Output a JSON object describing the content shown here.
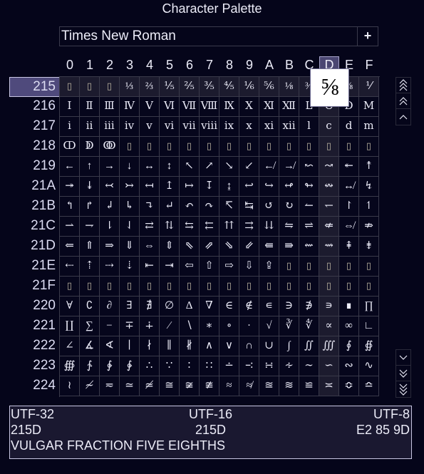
{
  "window": {
    "title": "Character Palette"
  },
  "font_selector": {
    "value": "Times New Roman",
    "add_button_label": "+"
  },
  "columns": [
    "0",
    "1",
    "2",
    "3",
    "4",
    "5",
    "6",
    "7",
    "8",
    "9",
    "A",
    "B",
    "C",
    "D",
    "E",
    "F"
  ],
  "hover": {
    "row": "215",
    "column": "D"
  },
  "missing_glyph": "▯",
  "rows": [
    {
      "label": "215",
      "chars": [
        "▯",
        "▯",
        "▯",
        "⅓",
        "⅔",
        "⅕",
        "⅖",
        "⅗",
        "⅘",
        "⅙",
        "⅚",
        "⅛",
        "⅜",
        "⅝",
        "⅞",
        "⅟"
      ]
    },
    {
      "label": "216",
      "chars": [
        "Ⅰ",
        "Ⅱ",
        "Ⅲ",
        "Ⅳ",
        "Ⅴ",
        "Ⅵ",
        "Ⅶ",
        "Ⅷ",
        "Ⅸ",
        "Ⅹ",
        "Ⅺ",
        "Ⅻ",
        "Ⅼ",
        "Ⅽ",
        "Ⅾ",
        "Ⅿ"
      ]
    },
    {
      "label": "217",
      "chars": [
        "ⅰ",
        "ⅱ",
        "ⅲ",
        "ⅳ",
        "ⅴ",
        "ⅵ",
        "ⅶ",
        "ⅷ",
        "ⅸ",
        "ⅹ",
        "ⅺ",
        "ⅻ",
        "ⅼ",
        "ⅽ",
        "ⅾ",
        "ⅿ"
      ]
    },
    {
      "label": "218",
      "chars": [
        "ↀ",
        "ↁ",
        "ↂ",
        "▯",
        "▯",
        "▯",
        "▯",
        "▯",
        "▯",
        "▯",
        "▯",
        "▯",
        "▯",
        "▯",
        "▯",
        "▯"
      ]
    },
    {
      "label": "219",
      "chars": [
        "←",
        "↑",
        "→",
        "↓",
        "↔",
        "↕",
        "↖",
        "↗",
        "↘",
        "↙",
        "↚",
        "↛",
        "↜",
        "↝",
        "↞",
        "↟"
      ]
    },
    {
      "label": "21A",
      "chars": [
        "↠",
        "↡",
        "↢",
        "↣",
        "↤",
        "↥",
        "↦",
        "↧",
        "↨",
        "↩",
        "↪",
        "↫",
        "↬",
        "↭",
        "↮",
        "↯"
      ]
    },
    {
      "label": "21B",
      "chars": [
        "↰",
        "↱",
        "↲",
        "↳",
        "↴",
        "↵",
        "↶",
        "↷",
        "↸",
        "↹",
        "↺",
        "↻",
        "↼",
        "↽",
        "↾",
        "↿"
      ]
    },
    {
      "label": "21C",
      "chars": [
        "⇀",
        "⇁",
        "⇂",
        "⇃",
        "⇄",
        "⇅",
        "⇆",
        "⇇",
        "⇈",
        "⇉",
        "⇊",
        "⇋",
        "⇌",
        "⇍",
        "⇎",
        "⇏"
      ]
    },
    {
      "label": "21D",
      "chars": [
        "⇐",
        "⇑",
        "⇒",
        "⇓",
        "⇔",
        "⇕",
        "⇖",
        "⇗",
        "⇘",
        "⇙",
        "⇚",
        "⇛",
        "⇜",
        "⇝",
        "⇞",
        "⇟"
      ]
    },
    {
      "label": "21E",
      "chars": [
        "⇠",
        "⇡",
        "⇢",
        "⇣",
        "⇤",
        "⇥",
        "⇦",
        "⇧",
        "⇨",
        "⇩",
        "⇪",
        "▯",
        "▯",
        "▯",
        "▯",
        "▯"
      ]
    },
    {
      "label": "21F",
      "chars": [
        "▯",
        "▯",
        "▯",
        "▯",
        "▯",
        "▯",
        "▯",
        "▯",
        "▯",
        "▯",
        "▯",
        "▯",
        "▯",
        "▯",
        "▯",
        "▯"
      ]
    },
    {
      "label": "220",
      "chars": [
        "∀",
        "∁",
        "∂",
        "∃",
        "∄",
        "∅",
        "∆",
        "∇",
        "∈",
        "∉",
        "∊",
        "∋",
        "∌",
        "∍",
        "∎",
        "∏"
      ]
    },
    {
      "label": "221",
      "chars": [
        "∐",
        "∑",
        "−",
        "∓",
        "∔",
        "∕",
        "∖",
        "∗",
        "∘",
        "∙",
        "√",
        "∛",
        "∜",
        "∝",
        "∞",
        "∟"
      ]
    },
    {
      "label": "222",
      "chars": [
        "∠",
        "∡",
        "∢",
        "∣",
        "∤",
        "∥",
        "∦",
        "∧",
        "∨",
        "∩",
        "∪",
        "∫",
        "∬",
        "∭",
        "∮",
        "∯"
      ]
    },
    {
      "label": "223",
      "chars": [
        "∰",
        "∱",
        "∲",
        "∳",
        "∴",
        "∵",
        "∶",
        "∷",
        "∸",
        "∹",
        "∺",
        "∻",
        "∼",
        "∽",
        "∾",
        "∿"
      ]
    },
    {
      "label": "224",
      "chars": [
        "≀",
        "≁",
        "≂",
        "≃",
        "≄",
        "≅",
        "≆",
        "≇",
        "≈",
        "≉",
        "≊",
        "≋",
        "≌",
        "≍",
        "≎",
        "≏"
      ]
    }
  ],
  "tooltip": {
    "glyph": "⅝"
  },
  "scroll": {
    "top_buttons": [
      "page-first-icon",
      "page-up-icon",
      "line-up-icon"
    ],
    "bottom_buttons": [
      "line-down-icon",
      "page-down-icon",
      "page-last-icon"
    ]
  },
  "info": {
    "utf32_label": "UTF-32",
    "utf16_label": "UTF-16",
    "utf8_label": "UTF-8",
    "utf32_value": "215D",
    "utf16_value": "215D",
    "utf8_value": "E2 85 9D",
    "name": "VULGAR FRACTION FIVE EIGHTHS"
  },
  "colors": {
    "background": "#05051a",
    "highlight": "#1c1b2e",
    "selection": "#4f4a7c",
    "grid_line": "#3a3a4a",
    "text": "#ececf8",
    "info_background": "#1a1830"
  }
}
